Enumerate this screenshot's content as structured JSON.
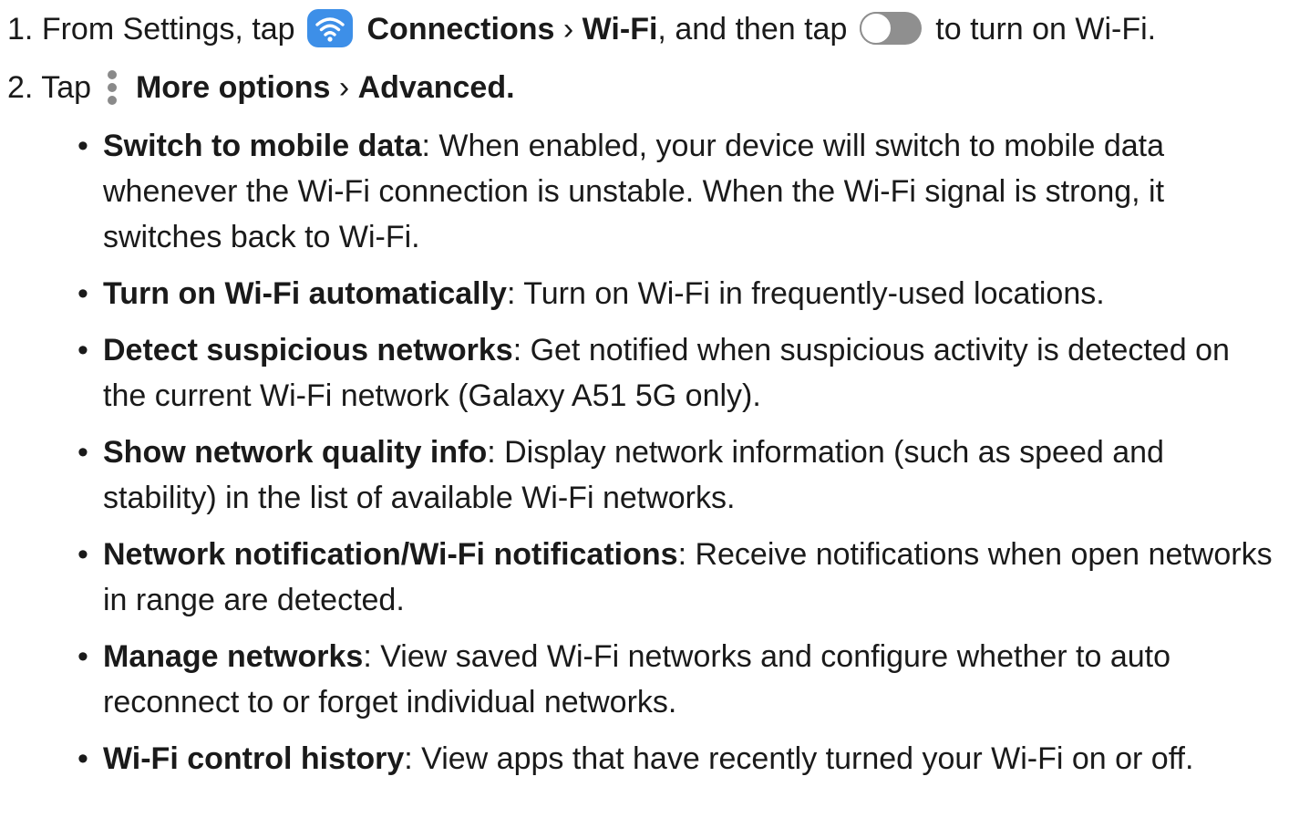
{
  "steps": [
    {
      "number": "1.",
      "parts": {
        "a": "From Settings, tap",
        "b": "Connections",
        "c": "›",
        "d": "Wi-Fi",
        "e": ", and then tap",
        "f": "to turn on Wi-Fi."
      },
      "icons": [
        "wifi-icon",
        "toggle-icon"
      ]
    },
    {
      "number": "2.",
      "parts": {
        "a": "Tap",
        "b": "More options",
        "c": "›",
        "d": "Advanced."
      },
      "icons": [
        "more-options-icon"
      ]
    }
  ],
  "colors": {
    "wifi_icon_bg": "#3d8fe8",
    "toggle_bg": "#8f8f8f",
    "kebab": "#8a8a8a",
    "text": "#1a1a1a"
  },
  "bullets": [
    {
      "term": "Switch to mobile data",
      "desc": ": When enabled, your device will switch to mobile data whenever the Wi-Fi connection is unstable. When the Wi-Fi signal is strong, it switches back to Wi-Fi."
    },
    {
      "term": "Turn on Wi-Fi automatically",
      "desc": ": Turn on Wi-Fi in frequently-used locations."
    },
    {
      "term": "Detect suspicious networks",
      "desc": ": Get notified when suspicious activity is detected on the current Wi-Fi network (Galaxy A51 5G only)."
    },
    {
      "term": "Show network quality info",
      "desc": ": Display network information (such as speed and stability) in the list of available Wi-Fi networks."
    },
    {
      "term": "Network notification/Wi-Fi notifications",
      "desc": ": Receive notifications when open networks in range are detected."
    },
    {
      "term": "Manage networks",
      "desc": ": View saved Wi-Fi networks and configure whether to auto reconnect to or forget individual networks."
    },
    {
      "term": "Wi-Fi control history",
      "desc": ": View apps that have recently turned your Wi-Fi on or off."
    }
  ]
}
